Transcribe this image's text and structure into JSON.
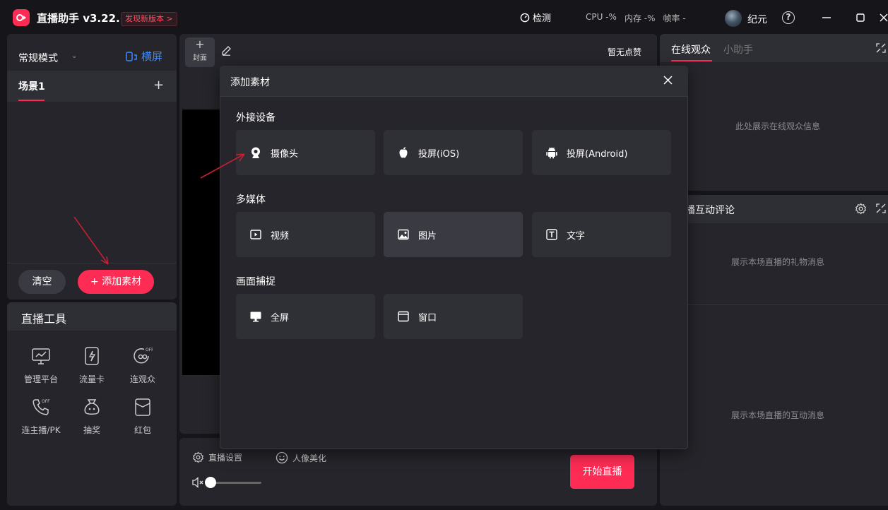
{
  "titlebar": {
    "app_name": "直播助手 v3.22.1",
    "update_link": "发现新版本 >",
    "detect_label": "检测",
    "cpu": "CPU -%",
    "memory": "内存 -%",
    "fps": "帧率 -",
    "username": "纪元",
    "help": "?"
  },
  "left": {
    "mode": "常规模式",
    "orientation": "横屏",
    "scene_tab": "场景1",
    "scene_add": "+",
    "clear_label": "清空",
    "add_material_label": "+ 添加素材"
  },
  "tools": {
    "title": "直播工具",
    "items": [
      {
        "label": "管理平台",
        "icon": "monitor-chart-icon"
      },
      {
        "label": "流量卡",
        "icon": "lightning-card-icon"
      },
      {
        "label": "连观众",
        "icon": "link-audience-off-icon"
      },
      {
        "label": "连主播/PK",
        "icon": "phone-off-icon"
      },
      {
        "label": "抽奖",
        "icon": "lottery-bag-icon"
      },
      {
        "label": "红包",
        "icon": "red-envelope-icon"
      }
    ]
  },
  "center": {
    "cover_plus": "+",
    "cover_label": "封面",
    "no_likes": "暂无点赞",
    "live_settings": "直播设置",
    "beauty": "人像美化",
    "volume_level": 0.0,
    "start_live": "开始直播"
  },
  "right": {
    "tab_online": "在线观众",
    "tab_assistant": "小助手",
    "online_info": "此处展示在线观众信息",
    "comments_title": "播互动评论",
    "gift_msg": "展示本场直播的礼物消息",
    "interact_msg": "展示本场直播的互动消息"
  },
  "modal": {
    "title": "添加素材",
    "sections": [
      {
        "title": "外接设备",
        "items": [
          {
            "label": "摄像头",
            "icon": "webcam-icon"
          },
          {
            "label": "投屏(iOS)",
            "icon": "apple-icon"
          },
          {
            "label": "投屏(Android)",
            "icon": "android-icon"
          }
        ]
      },
      {
        "title": "多媒体",
        "items": [
          {
            "label": "视频",
            "icon": "video-icon"
          },
          {
            "label": "图片",
            "icon": "image-icon"
          },
          {
            "label": "文字",
            "icon": "text-icon"
          }
        ]
      },
      {
        "title": "画面捕捉",
        "items": [
          {
            "label": "全屏",
            "icon": "monitor-icon"
          },
          {
            "label": "窗口",
            "icon": "window-icon"
          }
        ]
      }
    ]
  },
  "colors": {
    "accent": "#fe2c55",
    "link_blue": "#3d8cff",
    "panel": "#25252b",
    "background": "#16161a"
  }
}
